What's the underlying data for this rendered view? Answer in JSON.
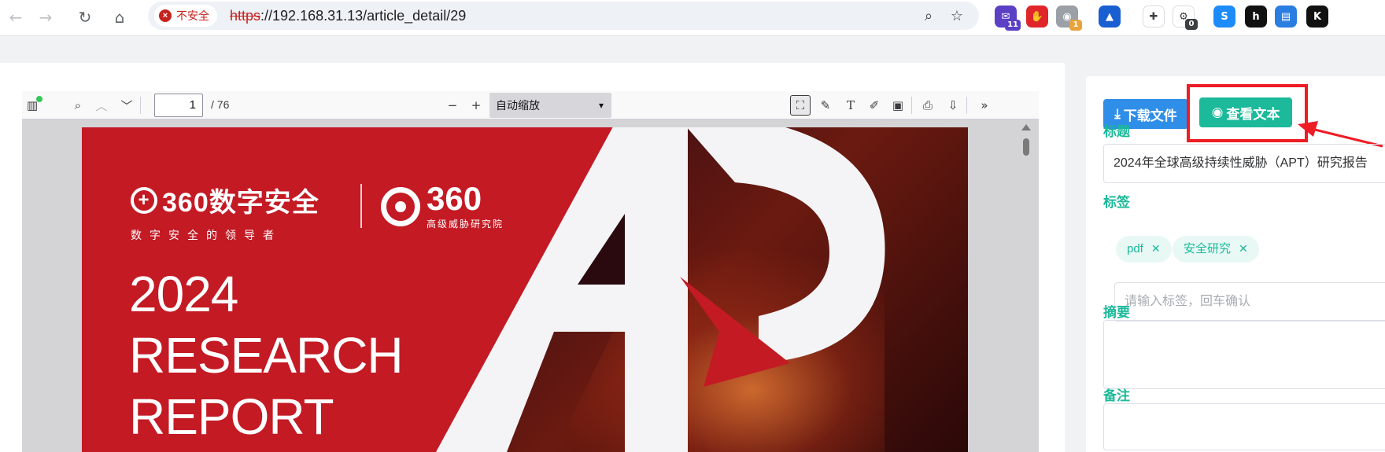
{
  "browser": {
    "security_label": "不安全",
    "url_scheme": "https",
    "url_rest": "://192.168.31.13/article_detail/29",
    "extensions": [
      {
        "name": "extension-mail",
        "color": "#5b3fc4",
        "glyph": "✉",
        "badge": "11",
        "badge_color": "#5b3fc4"
      },
      {
        "name": "extension-red",
        "color": "#e0262b",
        "glyph": "✋",
        "badge": "",
        "badge_color": ""
      },
      {
        "name": "extension-chrome",
        "color": "#9aa0a6",
        "glyph": "◉",
        "badge": "1",
        "badge_color": "#e8a33c"
      },
      {
        "name": "extension-blue",
        "color": "#1a5fd1",
        "glyph": "▲",
        "badge": "",
        "badge_color": ""
      },
      {
        "name": "extension-green",
        "color": "#ffffff",
        "glyph": "✚",
        "badge": "",
        "badge_color": ""
      },
      {
        "name": "extension-bug",
        "color": "#ffffff",
        "glyph": "⚙",
        "badge": "0",
        "badge_color": "#3c4043"
      },
      {
        "name": "extension-s",
        "color": "#1d8cf8",
        "glyph": "S",
        "badge": "",
        "badge_color": ""
      },
      {
        "name": "extension-h",
        "color": "#111111",
        "glyph": "h",
        "badge": "",
        "badge_color": ""
      },
      {
        "name": "extension-doc",
        "color": "#2a7de1",
        "glyph": "▤",
        "badge": "",
        "badge_color": ""
      },
      {
        "name": "extension-k",
        "color": "#111111",
        "glyph": "K",
        "badge": "",
        "badge_color": ""
      }
    ]
  },
  "pdf": {
    "page_number": "1",
    "page_total": "/ 76",
    "zoom": "自动缩放",
    "cover": {
      "brand_main": "360数字安全",
      "brand_slogan": "数字安全的领导者",
      "lab_number": "360",
      "lab_name": "高级威胁研究院",
      "year": "2024",
      "line2": "RESEARCH",
      "line3": "REPORT",
      "art_text": "APT"
    }
  },
  "panel": {
    "download_label": "下载文件",
    "view_text_label": "查看文本",
    "title_label": "标题",
    "title_value": "2024年全球高级持续性威胁（APT）研究报告",
    "tags_label": "标签",
    "tags": [
      "pdf",
      "安全研究"
    ],
    "tag_placeholder": "请输入标签，回车确认",
    "summary_label": "摘要",
    "notes_label": "备注",
    "accent_color": "#1cb99a",
    "highlight_color": "#ee1c25"
  }
}
